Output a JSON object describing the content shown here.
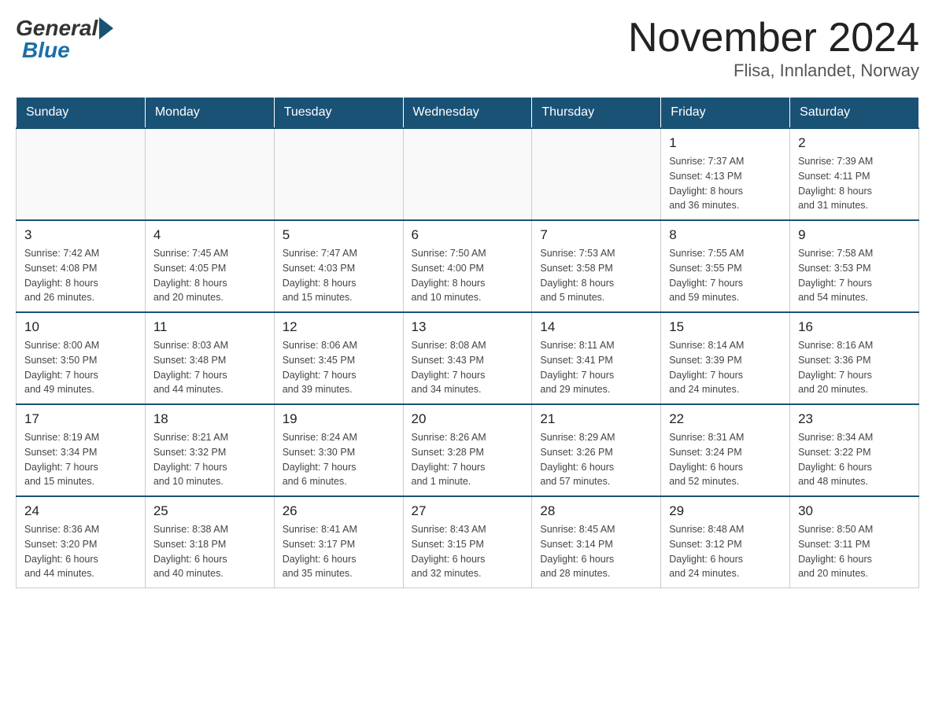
{
  "header": {
    "logo": {
      "general": "General",
      "blue": "Blue"
    },
    "title": "November 2024",
    "location": "Flisa, Innlandet, Norway"
  },
  "weekdays": [
    "Sunday",
    "Monday",
    "Tuesday",
    "Wednesday",
    "Thursday",
    "Friday",
    "Saturday"
  ],
  "weeks": [
    [
      {
        "day": "",
        "info": ""
      },
      {
        "day": "",
        "info": ""
      },
      {
        "day": "",
        "info": ""
      },
      {
        "day": "",
        "info": ""
      },
      {
        "day": "",
        "info": ""
      },
      {
        "day": "1",
        "info": "Sunrise: 7:37 AM\nSunset: 4:13 PM\nDaylight: 8 hours\nand 36 minutes."
      },
      {
        "day": "2",
        "info": "Sunrise: 7:39 AM\nSunset: 4:11 PM\nDaylight: 8 hours\nand 31 minutes."
      }
    ],
    [
      {
        "day": "3",
        "info": "Sunrise: 7:42 AM\nSunset: 4:08 PM\nDaylight: 8 hours\nand 26 minutes."
      },
      {
        "day": "4",
        "info": "Sunrise: 7:45 AM\nSunset: 4:05 PM\nDaylight: 8 hours\nand 20 minutes."
      },
      {
        "day": "5",
        "info": "Sunrise: 7:47 AM\nSunset: 4:03 PM\nDaylight: 8 hours\nand 15 minutes."
      },
      {
        "day": "6",
        "info": "Sunrise: 7:50 AM\nSunset: 4:00 PM\nDaylight: 8 hours\nand 10 minutes."
      },
      {
        "day": "7",
        "info": "Sunrise: 7:53 AM\nSunset: 3:58 PM\nDaylight: 8 hours\nand 5 minutes."
      },
      {
        "day": "8",
        "info": "Sunrise: 7:55 AM\nSunset: 3:55 PM\nDaylight: 7 hours\nand 59 minutes."
      },
      {
        "day": "9",
        "info": "Sunrise: 7:58 AM\nSunset: 3:53 PM\nDaylight: 7 hours\nand 54 minutes."
      }
    ],
    [
      {
        "day": "10",
        "info": "Sunrise: 8:00 AM\nSunset: 3:50 PM\nDaylight: 7 hours\nand 49 minutes."
      },
      {
        "day": "11",
        "info": "Sunrise: 8:03 AM\nSunset: 3:48 PM\nDaylight: 7 hours\nand 44 minutes."
      },
      {
        "day": "12",
        "info": "Sunrise: 8:06 AM\nSunset: 3:45 PM\nDaylight: 7 hours\nand 39 minutes."
      },
      {
        "day": "13",
        "info": "Sunrise: 8:08 AM\nSunset: 3:43 PM\nDaylight: 7 hours\nand 34 minutes."
      },
      {
        "day": "14",
        "info": "Sunrise: 8:11 AM\nSunset: 3:41 PM\nDaylight: 7 hours\nand 29 minutes."
      },
      {
        "day": "15",
        "info": "Sunrise: 8:14 AM\nSunset: 3:39 PM\nDaylight: 7 hours\nand 24 minutes."
      },
      {
        "day": "16",
        "info": "Sunrise: 8:16 AM\nSunset: 3:36 PM\nDaylight: 7 hours\nand 20 minutes."
      }
    ],
    [
      {
        "day": "17",
        "info": "Sunrise: 8:19 AM\nSunset: 3:34 PM\nDaylight: 7 hours\nand 15 minutes."
      },
      {
        "day": "18",
        "info": "Sunrise: 8:21 AM\nSunset: 3:32 PM\nDaylight: 7 hours\nand 10 minutes."
      },
      {
        "day": "19",
        "info": "Sunrise: 8:24 AM\nSunset: 3:30 PM\nDaylight: 7 hours\nand 6 minutes."
      },
      {
        "day": "20",
        "info": "Sunrise: 8:26 AM\nSunset: 3:28 PM\nDaylight: 7 hours\nand 1 minute."
      },
      {
        "day": "21",
        "info": "Sunrise: 8:29 AM\nSunset: 3:26 PM\nDaylight: 6 hours\nand 57 minutes."
      },
      {
        "day": "22",
        "info": "Sunrise: 8:31 AM\nSunset: 3:24 PM\nDaylight: 6 hours\nand 52 minutes."
      },
      {
        "day": "23",
        "info": "Sunrise: 8:34 AM\nSunset: 3:22 PM\nDaylight: 6 hours\nand 48 minutes."
      }
    ],
    [
      {
        "day": "24",
        "info": "Sunrise: 8:36 AM\nSunset: 3:20 PM\nDaylight: 6 hours\nand 44 minutes."
      },
      {
        "day": "25",
        "info": "Sunrise: 8:38 AM\nSunset: 3:18 PM\nDaylight: 6 hours\nand 40 minutes."
      },
      {
        "day": "26",
        "info": "Sunrise: 8:41 AM\nSunset: 3:17 PM\nDaylight: 6 hours\nand 35 minutes."
      },
      {
        "day": "27",
        "info": "Sunrise: 8:43 AM\nSunset: 3:15 PM\nDaylight: 6 hours\nand 32 minutes."
      },
      {
        "day": "28",
        "info": "Sunrise: 8:45 AM\nSunset: 3:14 PM\nDaylight: 6 hours\nand 28 minutes."
      },
      {
        "day": "29",
        "info": "Sunrise: 8:48 AM\nSunset: 3:12 PM\nDaylight: 6 hours\nand 24 minutes."
      },
      {
        "day": "30",
        "info": "Sunrise: 8:50 AM\nSunset: 3:11 PM\nDaylight: 6 hours\nand 20 minutes."
      }
    ]
  ]
}
